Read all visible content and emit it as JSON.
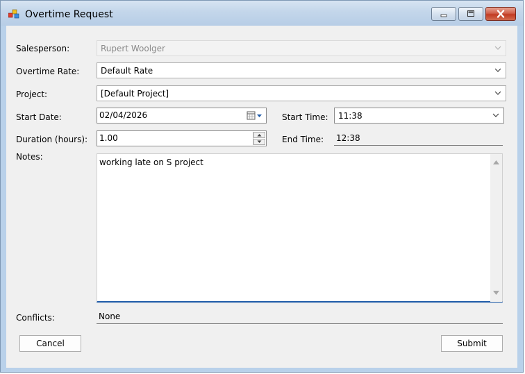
{
  "window": {
    "title": "Overtime Request"
  },
  "form": {
    "salesperson": {
      "label": "Salesperson:",
      "value": "Rupert Woolger"
    },
    "overtime_rate": {
      "label": "Overtime Rate:",
      "value": "Default Rate"
    },
    "project": {
      "label": "Project:",
      "value": "[Default Project]"
    },
    "start_date": {
      "label": "Start Date:",
      "value": "02/04/2026"
    },
    "start_time": {
      "label": "Start Time:",
      "value": "11:38"
    },
    "duration": {
      "label": "Duration (hours):",
      "value": "1.00"
    },
    "end_time": {
      "label": "End Time:",
      "value": "12:38"
    },
    "notes": {
      "label": "Notes:",
      "value": "working late on S project"
    },
    "conflicts": {
      "label": "Conflicts:",
      "value": "None"
    }
  },
  "buttons": {
    "cancel": "Cancel",
    "submit": "Submit"
  },
  "icons": {
    "app": "app-icon",
    "minimize": "minimize-icon",
    "maximize": "maximize-icon",
    "close": "close-icon",
    "dropdown": "chevron-down-icon",
    "calendar": "calendar-icon"
  },
  "colors": {
    "focus_accent": "#1e5aa8",
    "close_button": "#c23b22"
  }
}
